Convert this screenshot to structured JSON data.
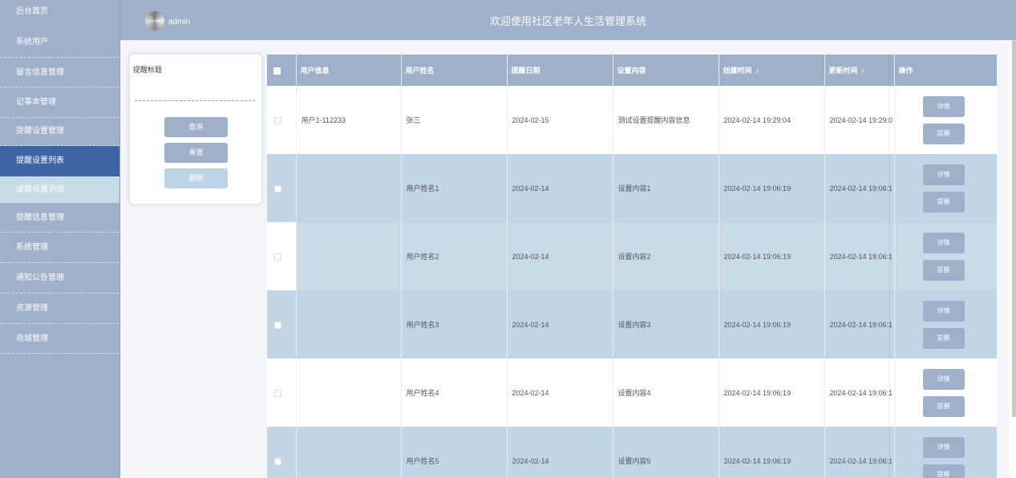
{
  "sidebar": {
    "items": [
      {
        "label": "后台首页"
      },
      {
        "label": "系统用户"
      },
      {
        "label": "留言信息管理"
      },
      {
        "label": "记事本管理"
      },
      {
        "label": "提醒设置管理"
      },
      {
        "label": "提醒设置列表"
      },
      {
        "label": "提醒设置添加"
      },
      {
        "label": "提醒信息管理"
      },
      {
        "label": "系统管理"
      },
      {
        "label": "通知公告管理"
      },
      {
        "label": "资源管理"
      },
      {
        "label": "商城管理"
      }
    ]
  },
  "header": {
    "user": "admin",
    "title": "欢迎使用社区老年人生活管理系统"
  },
  "search": {
    "label": "提醒标题",
    "value": "",
    "query_label": "查询",
    "reset_label": "重置",
    "delete_label": "删除"
  },
  "table": {
    "headers": [
      "用户信息",
      "用户姓名",
      "提醒日期",
      "设置内容",
      "创建时间",
      "更新时间",
      "操作"
    ],
    "sort_icon": "⇕",
    "detail_label": "详情",
    "remind_label": "提醒",
    "rows": [
      {
        "user_info": "用户1-112233",
        "name": "张三",
        "date": "2024-02-15",
        "content": "测试设置提醒内容信息",
        "created": "2024-02-14 19:29:04",
        "updated": "2024-02-14 19:29:0"
      },
      {
        "user_info": "",
        "name": "用户姓名1",
        "date": "2024-02-14",
        "content": "设置内容1",
        "created": "2024-02-14 19:06:19",
        "updated": "2024-02-14 19:06:1"
      },
      {
        "user_info": "",
        "name": "用户姓名2",
        "date": "2024-02-14",
        "content": "设置内容2",
        "created": "2024-02-14 19:06:19",
        "updated": "2024-02-14 19:06:1"
      },
      {
        "user_info": "",
        "name": "用户姓名3",
        "date": "2024-02-14",
        "content": "设置内容3",
        "created": "2024-02-14 19:06:19",
        "updated": "2024-02-14 19:06:1"
      },
      {
        "user_info": "",
        "name": "用户姓名4",
        "date": "2024-02-14",
        "content": "设置内容4",
        "created": "2024-02-14 19:06:19",
        "updated": "2024-02-14 19:06:1"
      },
      {
        "user_info": "",
        "name": "用户姓名5",
        "date": "2024-02-14",
        "content": "设置内容5",
        "created": "2024-02-14 19:06:19",
        "updated": "2024-02-14 19:06:1"
      }
    ]
  },
  "colors": {
    "primary": "#9fb0cb",
    "active": "#3f64a6",
    "row_highlight": "#c0d6e6"
  }
}
